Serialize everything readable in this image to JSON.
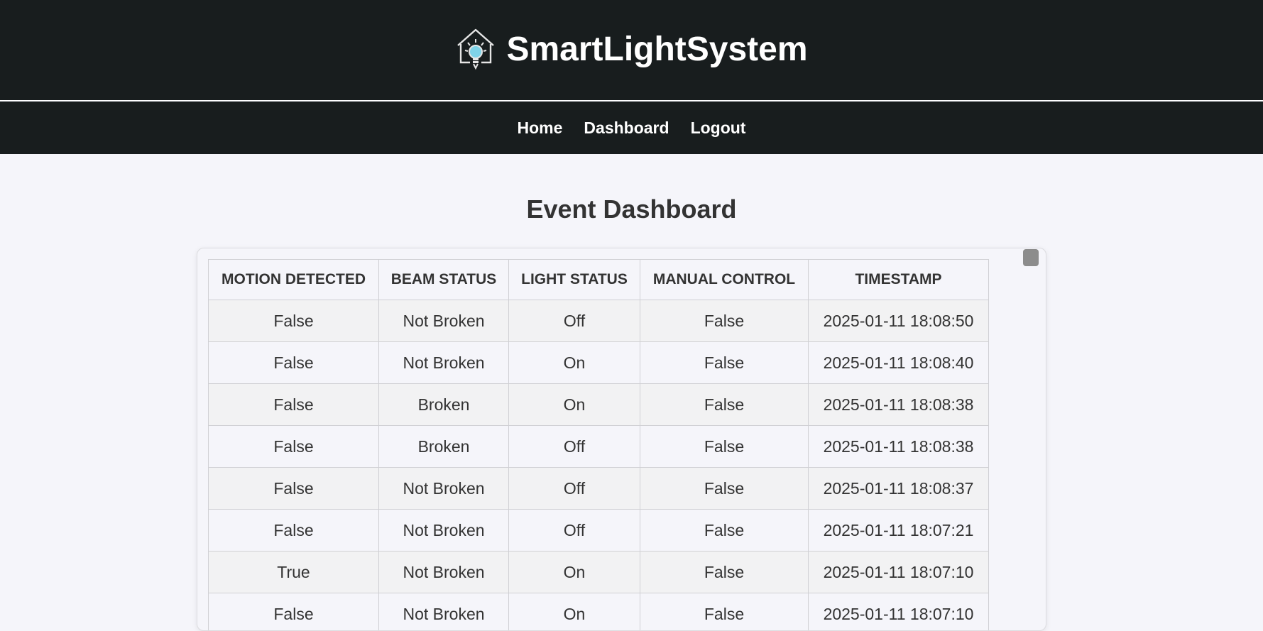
{
  "header": {
    "title": "SmartLightSystem",
    "logo_icon": "smart-home-bulb-icon"
  },
  "nav": {
    "items": [
      {
        "label": "Home"
      },
      {
        "label": "Dashboard"
      },
      {
        "label": "Logout"
      }
    ]
  },
  "main": {
    "title": "Event Dashboard"
  },
  "table": {
    "columns": [
      "MOTION DETECTED",
      "BEAM STATUS",
      "LIGHT STATUS",
      "MANUAL CONTROL",
      "TIMESTAMP"
    ],
    "rows": [
      [
        "False",
        "Not Broken",
        "Off",
        "False",
        "2025-01-11 18:08:50"
      ],
      [
        "False",
        "Not Broken",
        "On",
        "False",
        "2025-01-11 18:08:40"
      ],
      [
        "False",
        "Broken",
        "On",
        "False",
        "2025-01-11 18:08:38"
      ],
      [
        "False",
        "Broken",
        "Off",
        "False",
        "2025-01-11 18:08:38"
      ],
      [
        "False",
        "Not Broken",
        "Off",
        "False",
        "2025-01-11 18:08:37"
      ],
      [
        "False",
        "Not Broken",
        "Off",
        "False",
        "2025-01-11 18:07:21"
      ],
      [
        "True",
        "Not Broken",
        "On",
        "False",
        "2025-01-11 18:07:10"
      ],
      [
        "False",
        "Not Broken",
        "On",
        "False",
        "2025-01-11 18:07:10"
      ]
    ]
  },
  "colors": {
    "header_bg": "#181d1e",
    "page_bg": "#f5f5fa",
    "text": "#333333",
    "logo_accent": "#7fd3e8"
  }
}
